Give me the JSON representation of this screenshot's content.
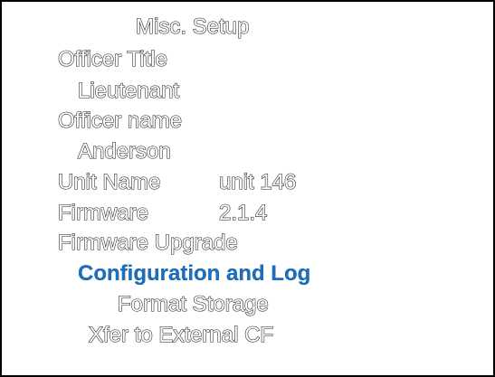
{
  "menu": {
    "title": "Misc. Setup",
    "officer_title_label": "Officer Title",
    "officer_title_value": "Lieutenant",
    "officer_name_label": "Officer name",
    "officer_name_value": "Anderson",
    "unit_name_label": "Unit Name",
    "unit_name_value": "unit 146",
    "firmware_label": "Firmware",
    "firmware_value": "2.1.4",
    "firmware_upgrade_label": "Firmware Upgrade",
    "configuration_and_log_label": "Configuration and Log",
    "format_storage_label": "Format Storage",
    "xfer_label": "Xfer to External CF",
    "colors": {
      "selected_text": "#1a6fc0",
      "outline": "#1a1a1a",
      "background": "#ffffff",
      "border": "#000000"
    }
  }
}
